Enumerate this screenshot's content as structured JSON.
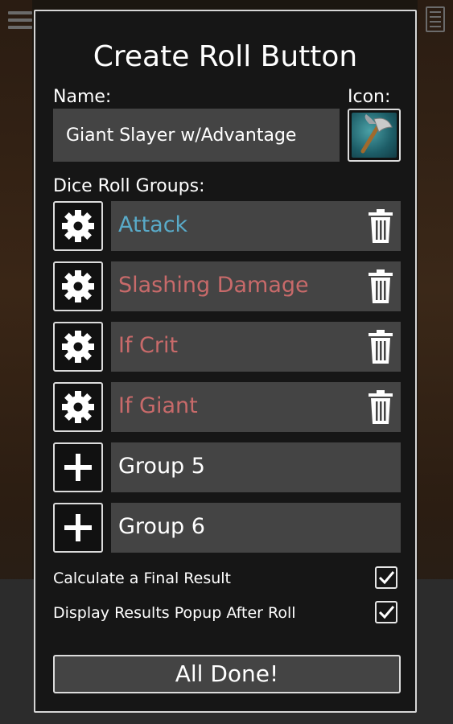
{
  "dialog": {
    "title": "Create Roll Button",
    "name_label": "Name:",
    "name_value": "Giant Slayer w/Advantage",
    "icon_label": "Icon:",
    "icon_name": "battle-axe-icon",
    "groups_label": "Dice Roll Groups:",
    "groups": [
      {
        "name": "Attack",
        "color": "#59aac8",
        "action": "settings",
        "deletable": true
      },
      {
        "name": "Slashing Damage",
        "color": "#c86a6a",
        "action": "settings",
        "deletable": true
      },
      {
        "name": "If Crit",
        "color": "#c86a6a",
        "action": "settings",
        "deletable": true
      },
      {
        "name": "If Giant",
        "color": "#c86a6a",
        "action": "settings",
        "deletable": true
      },
      {
        "name": "Group 5",
        "color": "#ffffff",
        "action": "add",
        "deletable": false
      },
      {
        "name": "Group 6",
        "color": "#ffffff",
        "action": "add",
        "deletable": false
      }
    ],
    "options": [
      {
        "label": "Calculate a Final Result",
        "checked": true
      },
      {
        "label": "Display Results Popup After Roll",
        "checked": true
      }
    ],
    "done_label": "All Done!"
  }
}
